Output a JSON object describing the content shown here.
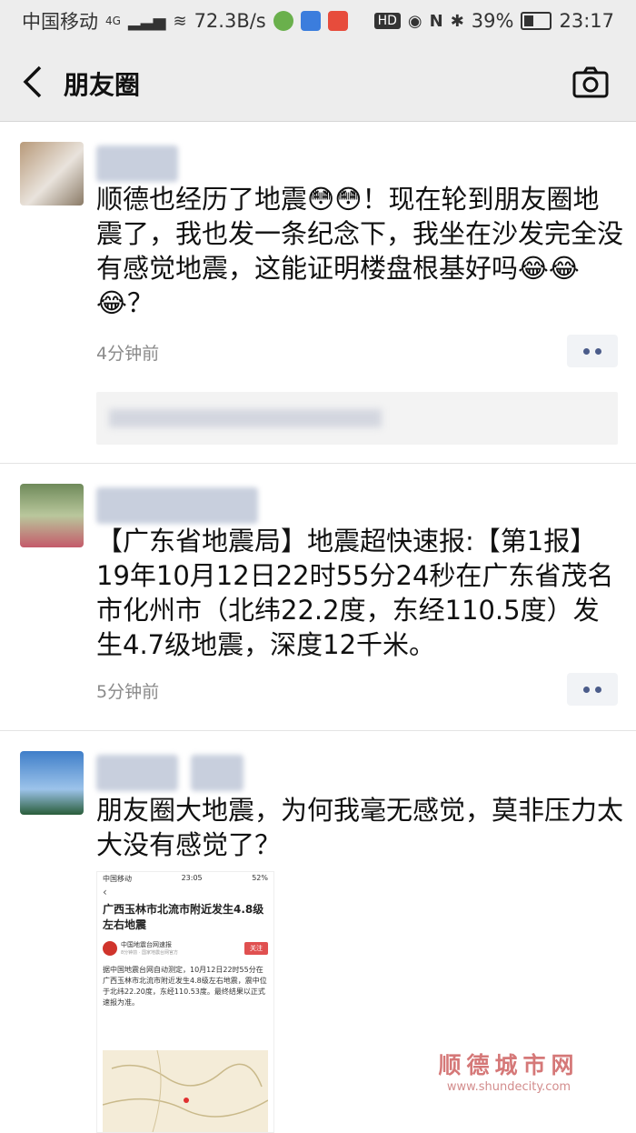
{
  "status_bar": {
    "carrier": "中国移动",
    "network": "4G",
    "speed": "72.3B/s",
    "battery": "39%",
    "time": "23:17"
  },
  "nav": {
    "title": "朋友圈",
    "back_icon": "chevron-left-icon",
    "camera_icon": "camera-icon"
  },
  "posts": [
    {
      "text": "顺德也经历了地震😳😳！现在轮到朋友圈地震了，我也发一条纪念下，我坐在沙发完全没有感觉地震，这能证明楼盘根基好吗😂😂😂？",
      "time": "4分钟前"
    },
    {
      "text": "【广东省地震局】地震超快速报:【第1报】19年10月12日22时55分24秒在广东省茂名市化州市（北纬22.2度，东经110.5度）发生4.7级地震，深度12千米。",
      "time": "5分钟前"
    },
    {
      "text": "朋友圈大地震，为何我毫无感觉，莫非压力太大没有感觉了？"
    }
  ],
  "embedded_screenshot": {
    "carrier": "中国移动",
    "time": "23:05",
    "battery": "52%",
    "title": "广西玉林市北流市附近发生4.8级左右地震",
    "source": "中国地震台网速报",
    "source_sub": "8分钟前 · 国家地震台网官方",
    "follow": "关注",
    "body": "据中国地震台网自动测定，10月12日22时55分在广西玉林市北流市附近发生4.8级左右地震，震中位于北纬22.20度，东经110.53度。最终结果以正式速报为准。"
  },
  "watermark": {
    "name": "顺德城市网",
    "url": "www.shundecity.com"
  },
  "colors": {
    "header_bg": "#ededed",
    "more_dots": "#4b5c8a",
    "time": "#8a8a8a",
    "watermark": "#c84c4c"
  }
}
